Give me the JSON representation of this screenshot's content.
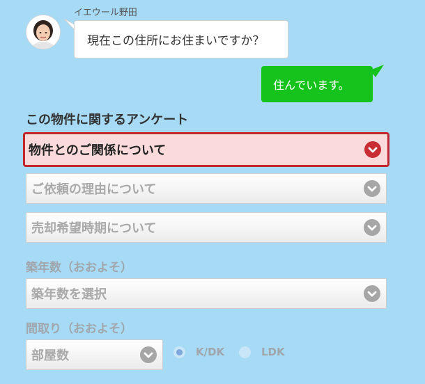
{
  "chat": {
    "agent_name": "イエウール野田",
    "question": "現在この住所にお住まいですか？",
    "answer": "住んでいます。"
  },
  "survey": {
    "title": "この物件に関するアンケート",
    "relationship_select": "物件とのご関係について",
    "reason_select": "ご依頼の理由について",
    "timing_select": "売却希望時期について",
    "building_age": {
      "label": "築年数（おおよそ）",
      "select": "築年数を選択"
    },
    "floor_plan": {
      "label": "間取り（おおよそ）",
      "rooms_select": "部屋数",
      "options": [
        "K/DK",
        "LDK"
      ],
      "selected": "K/DK"
    }
  },
  "colors": {
    "background": "#a6daf5",
    "answer_bubble": "#16c21c",
    "active_border": "#c2272d",
    "active_fill": "#fadadb"
  }
}
